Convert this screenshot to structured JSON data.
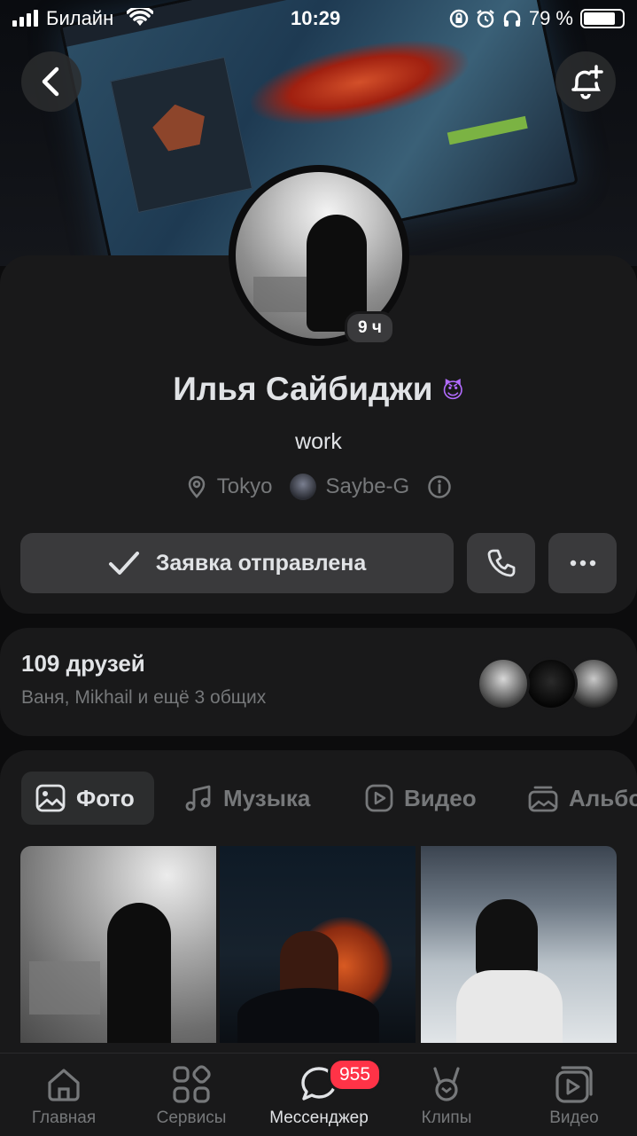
{
  "status_bar": {
    "carrier": "Билайн",
    "time": "10:29",
    "battery": "79 %"
  },
  "profile": {
    "name": "Илья Сайбиджи",
    "name_emoji": "😈",
    "status": "work",
    "city": "Tokyo",
    "work": "Saybe-G",
    "story_age": "9 ч"
  },
  "actions": {
    "request_label": "Заявка отправлена"
  },
  "friends": {
    "title": "109 друзей",
    "mutual": "Ваня, Mikhail и ещё 3 общих"
  },
  "tabs": [
    "Фото",
    "Музыка",
    "Видео",
    "Альбомы"
  ],
  "bottom_nav": [
    {
      "label": "Главная",
      "icon": "home-icon"
    },
    {
      "label": "Сервисы",
      "icon": "services-icon"
    },
    {
      "label": "Мессенджер",
      "icon": "messenger-icon",
      "badge": "955"
    },
    {
      "label": "Клипы",
      "icon": "clips-icon"
    },
    {
      "label": "Видео",
      "icon": "video-icon"
    }
  ],
  "colors": {
    "background": "#0c0c0d",
    "card": "#19191a",
    "button": "#3a3a3c",
    "accent_badge": "#ff3347",
    "text": "#e1e3e6",
    "secondary": "#76787a"
  }
}
